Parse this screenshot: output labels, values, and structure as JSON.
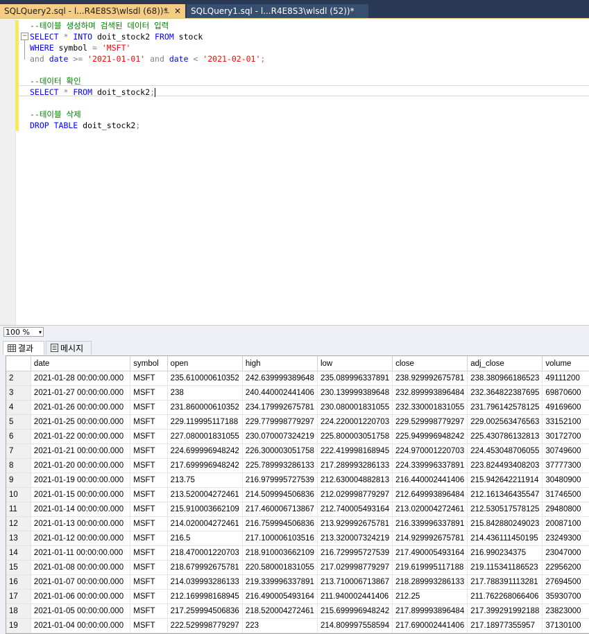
{
  "tabs": [
    {
      "title": "SQLQuery2.sql - l...R4E8S3\\wlsdl (68))*",
      "pin": "⊥",
      "close": "✕"
    },
    {
      "title": "SQLQuery1.sql - l...R4E8S3\\wlsdl (52))*"
    }
  ],
  "editor": {
    "comment1": "--테이블 생성하며 검색된 데이터 입력",
    "l2_select": "SELECT",
    "l2_star": " * ",
    "l2_into": "INTO",
    "l2_tbl": " doit_stock2 ",
    "l2_from": "FROM",
    "l2_src": " stock",
    "l3_where": "WHERE",
    "l3_col": " symbol ",
    "l3_eq": "=",
    "l3_val": " 'MSFT'",
    "l4_and1": "and",
    "l4_date1": " date ",
    "l4_ge": ">=",
    "l4_v1": " '2021-01-01' ",
    "l4_and2": "and",
    "l4_date2": " date ",
    "l4_lt": "<",
    "l4_v2": " '2021-02-01'",
    "l4_semi": ";",
    "comment2": "--데이터 확인",
    "l7_select": "SELECT",
    "l7_star": " * ",
    "l7_from": "FROM",
    "l7_tbl": " doit_stock2",
    "l7_semi": ";",
    "comment3": "--테이블 삭제",
    "l10_drop": "DROP TABLE",
    "l10_tbl": " doit_stock2",
    "l10_semi": ";"
  },
  "zoom": {
    "value": "100 %",
    "arrow": "▾"
  },
  "results_tabs": {
    "results": "결과",
    "messages": "메시지"
  },
  "grid": {
    "columns": [
      "date",
      "symbol",
      "open",
      "high",
      "low",
      "close",
      "adj_close",
      "volume"
    ],
    "rows": [
      [
        "2",
        "2021-01-28 00:00:00.000",
        "MSFT",
        "235.610000610352",
        "242.639999389648",
        "235.089996337891",
        "238.929992675781",
        "238.380966186523",
        "49111200"
      ],
      [
        "3",
        "2021-01-27 00:00:00.000",
        "MSFT",
        "238",
        "240.440002441406",
        "230.139999389648",
        "232.899993896484",
        "232.364822387695",
        "69870600"
      ],
      [
        "4",
        "2021-01-26 00:00:00.000",
        "MSFT",
        "231.860000610352",
        "234.179992675781",
        "230.080001831055",
        "232.330001831055",
        "231.796142578125",
        "49169600"
      ],
      [
        "5",
        "2021-01-25 00:00:00.000",
        "MSFT",
        "229.119995117188",
        "229.779998779297",
        "224.220001220703",
        "229.529998779297",
        "229.002563476563",
        "33152100"
      ],
      [
        "6",
        "2021-01-22 00:00:00.000",
        "MSFT",
        "227.080001831055",
        "230.070007324219",
        "225.800003051758",
        "225.949996948242",
        "225.430786132813",
        "30172700"
      ],
      [
        "7",
        "2021-01-21 00:00:00.000",
        "MSFT",
        "224.699996948242",
        "226.300003051758",
        "222.419998168945",
        "224.970001220703",
        "224.453048706055",
        "30749600"
      ],
      [
        "8",
        "2021-01-20 00:00:00.000",
        "MSFT",
        "217.699996948242",
        "225.789993286133",
        "217.289993286133",
        "224.339996337891",
        "223.824493408203",
        "37777300"
      ],
      [
        "9",
        "2021-01-19 00:00:00.000",
        "MSFT",
        "213.75",
        "216.979995727539",
        "212.630004882813",
        "216.440002441406",
        "215.942642211914",
        "30480900"
      ],
      [
        "10",
        "2021-01-15 00:00:00.000",
        "MSFT",
        "213.520004272461",
        "214.509994506836",
        "212.029998779297",
        "212.649993896484",
        "212.161346435547",
        "31746500"
      ],
      [
        "11",
        "2021-01-14 00:00:00.000",
        "MSFT",
        "215.910003662109",
        "217.460006713867",
        "212.740005493164",
        "213.020004272461",
        "212.530517578125",
        "29480800"
      ],
      [
        "12",
        "2021-01-13 00:00:00.000",
        "MSFT",
        "214.020004272461",
        "216.759994506836",
        "213.929992675781",
        "216.339996337891",
        "215.842880249023",
        "20087100"
      ],
      [
        "13",
        "2021-01-12 00:00:00.000",
        "MSFT",
        "216.5",
        "217.100006103516",
        "213.320007324219",
        "214.929992675781",
        "214.436111450195",
        "23249300"
      ],
      [
        "14",
        "2021-01-11 00:00:00.000",
        "MSFT",
        "218.470001220703",
        "218.910003662109",
        "216.729995727539",
        "217.490005493164",
        "216.990234375",
        "23047000"
      ],
      [
        "15",
        "2021-01-08 00:00:00.000",
        "MSFT",
        "218.679992675781",
        "220.580001831055",
        "217.029998779297",
        "219.619995117188",
        "219.115341186523",
        "22956200"
      ],
      [
        "16",
        "2021-01-07 00:00:00.000",
        "MSFT",
        "214.039993286133",
        "219.339996337891",
        "213.710006713867",
        "218.289993286133",
        "217.788391113281",
        "27694500"
      ],
      [
        "17",
        "2021-01-06 00:00:00.000",
        "MSFT",
        "212.169998168945",
        "216.490005493164",
        "211.940002441406",
        "212.25",
        "211.762268066406",
        "35930700"
      ],
      [
        "18",
        "2021-01-05 00:00:00.000",
        "MSFT",
        "217.259994506836",
        "218.520004272461",
        "215.699996948242",
        "217.899993896484",
        "217.399291992188",
        "23823000"
      ],
      [
        "19",
        "2021-01-04 00:00:00.000",
        "MSFT",
        "222.529998779297",
        "223",
        "214.809997558594",
        "217.690002441406",
        "217.18977355957",
        "37130100"
      ]
    ]
  }
}
